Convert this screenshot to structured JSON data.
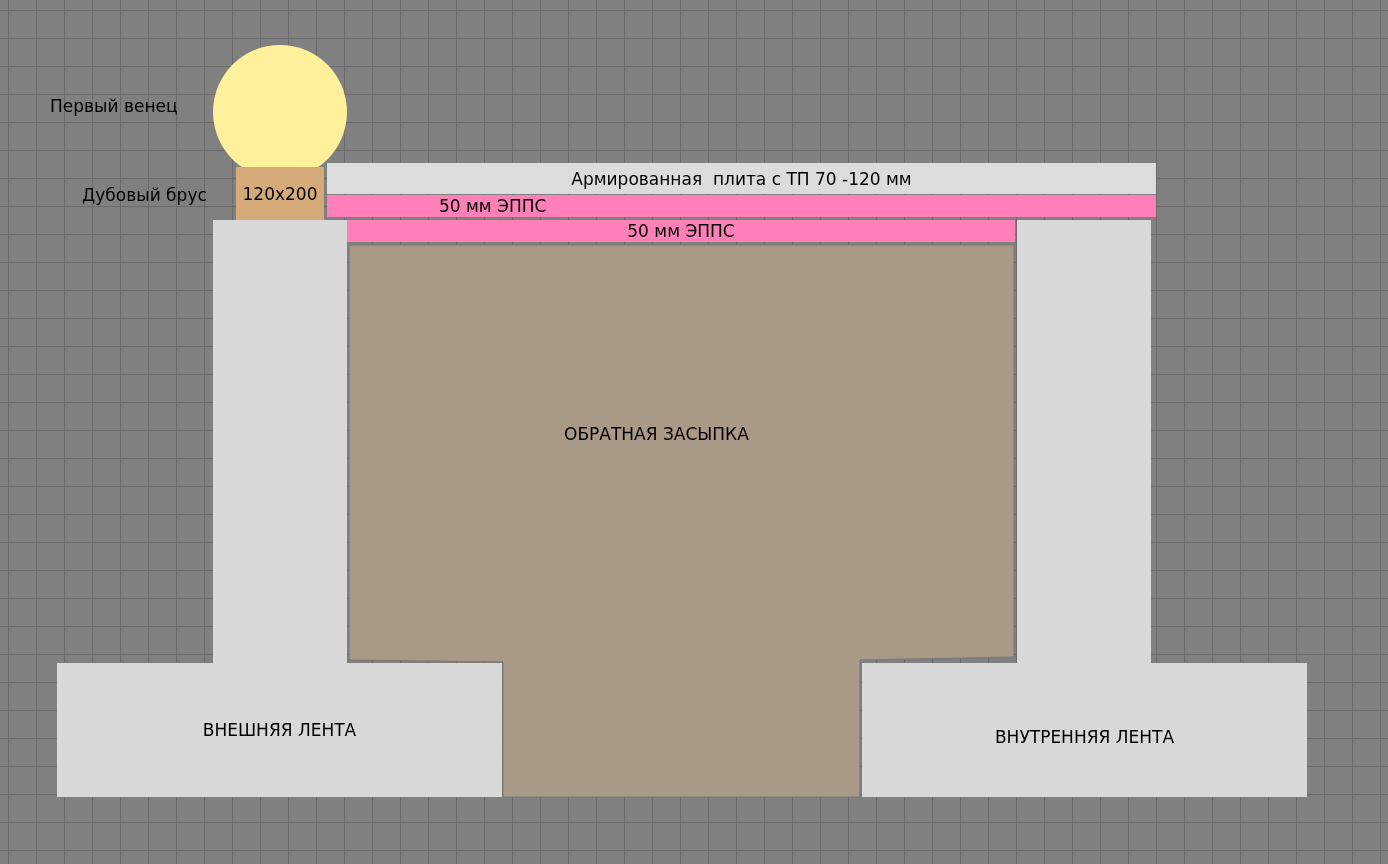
{
  "diagram": {
    "first_crown_label": "Первый венец",
    "oak_beam_label": "Дубовый брус",
    "oak_beam_size": "120x200",
    "slab": "Армированная  плита с ТП 70 -120 мм",
    "insulation_upper": "50 мм ЭППС",
    "insulation_lower": "50 мм ЭППС",
    "backfill": "ОБРАТНАЯ ЗАСЫПКА",
    "outer_strip": "ВНЕШНЯЯ ЛЕНТА",
    "inner_strip": "ВНУТРЕННЯЯ ЛЕНТА"
  }
}
